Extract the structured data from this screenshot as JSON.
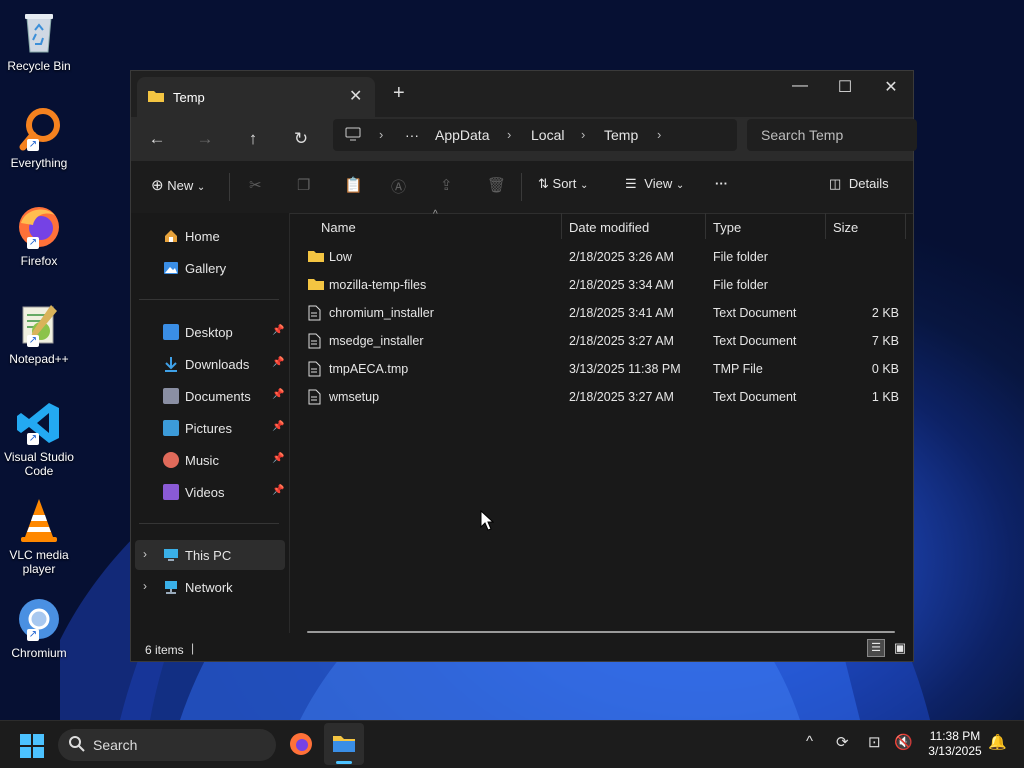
{
  "desktop": {
    "icons": [
      {
        "label": "Recycle Bin"
      },
      {
        "label": "Everything"
      },
      {
        "label": "Firefox"
      },
      {
        "label": "Notepad++"
      },
      {
        "label": "Visual Studio Code"
      },
      {
        "label": "VLC media player"
      },
      {
        "label": "Chromium"
      }
    ]
  },
  "window": {
    "tab_title": "Temp",
    "new_tab": "+",
    "address": {
      "segments": [
        "AppData",
        "Local",
        "Temp"
      ],
      "overflow": "···"
    },
    "search_placeholder": "Search Temp",
    "toolbar": {
      "new_label": "New",
      "sort_label": "Sort",
      "view_label": "View",
      "more_label": "···",
      "details_label": "Details"
    }
  },
  "sidebar": {
    "top": [
      {
        "label": "Home"
      },
      {
        "label": "Gallery"
      }
    ],
    "pinned": [
      {
        "label": "Desktop",
        "color": "#3a8ee6"
      },
      {
        "label": "Downloads",
        "color": "#3fa1e8"
      },
      {
        "label": "Documents",
        "color": "#8a8fa3"
      },
      {
        "label": "Pictures",
        "color": "#3c9bd9"
      },
      {
        "label": "Music",
        "color": "#e06a5a"
      },
      {
        "label": "Videos",
        "color": "#8a5ad6"
      }
    ],
    "bottom": [
      {
        "label": "This PC"
      },
      {
        "label": "Network"
      }
    ]
  },
  "file_list": {
    "columns": [
      "Name",
      "Date modified",
      "Type",
      "Size"
    ],
    "rows": [
      {
        "name": "Low",
        "date": "2/18/2025 3:26 AM",
        "type": "File folder",
        "size": "",
        "kind": "folder"
      },
      {
        "name": "mozilla-temp-files",
        "date": "2/18/2025 3:34 AM",
        "type": "File folder",
        "size": "",
        "kind": "folder"
      },
      {
        "name": "chromium_installer",
        "date": "2/18/2025 3:41 AM",
        "type": "Text Document",
        "size": "2 KB",
        "kind": "file"
      },
      {
        "name": "msedge_installer",
        "date": "2/18/2025 3:27 AM",
        "type": "Text Document",
        "size": "7 KB",
        "kind": "file"
      },
      {
        "name": "tmpAECA.tmp",
        "date": "3/13/2025 11:38 PM",
        "type": "TMP File",
        "size": "0 KB",
        "kind": "file"
      },
      {
        "name": "wmsetup",
        "date": "2/18/2025 3:27 AM",
        "type": "Text Document",
        "size": "1 KB",
        "kind": "file"
      }
    ]
  },
  "status": {
    "items_count": "6 items"
  },
  "taskbar": {
    "search_placeholder": "Search",
    "time": "11:38 PM",
    "date": "3/13/2025"
  },
  "colors": {
    "accent": "#0078d4",
    "folder": "#f4c542"
  }
}
